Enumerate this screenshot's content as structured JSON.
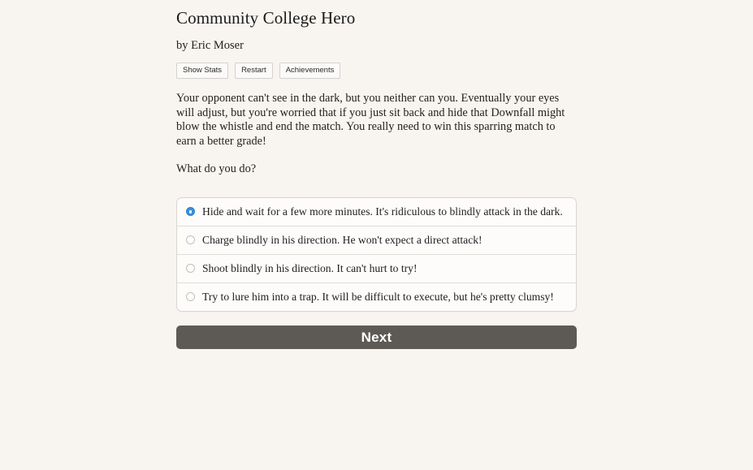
{
  "page": {
    "background_color": "#f8f5f1",
    "title": "Community College Hero",
    "byline": "by Eric Moser"
  },
  "toolbar": {
    "buttons": [
      {
        "label": "Show Stats",
        "name": "show-stats-button"
      },
      {
        "label": "Restart",
        "name": "restart-button"
      },
      {
        "label": "Achievements",
        "name": "achievements-button"
      }
    ]
  },
  "story": {
    "paragraph": "Your opponent can't see in the dark, but you neither can you. Eventually your eyes will adjust, but you're worried that if you just sit back and hide that Downfall might blow the whistle and end the match. You really need to win this sparring match to earn a better grade!",
    "prompt": "What do you do?"
  },
  "choices": {
    "selected_index": 0,
    "accent_color": "#3a8fdd",
    "options": [
      {
        "label": "Hide and wait for a few more minutes. It's ridiculous to blindly attack in the dark.",
        "selected": true
      },
      {
        "label": "Charge blindly in his direction. He won't expect a direct attack!",
        "selected": false
      },
      {
        "label": "Shoot blindly in his direction. It can't hurt to try!",
        "selected": false
      },
      {
        "label": "Try to lure him into a trap. It will be difficult to execute, but he's pretty clumsy!",
        "selected": false
      }
    ]
  },
  "actions": {
    "next_label": "Next",
    "next_color": "#5d5a56"
  }
}
